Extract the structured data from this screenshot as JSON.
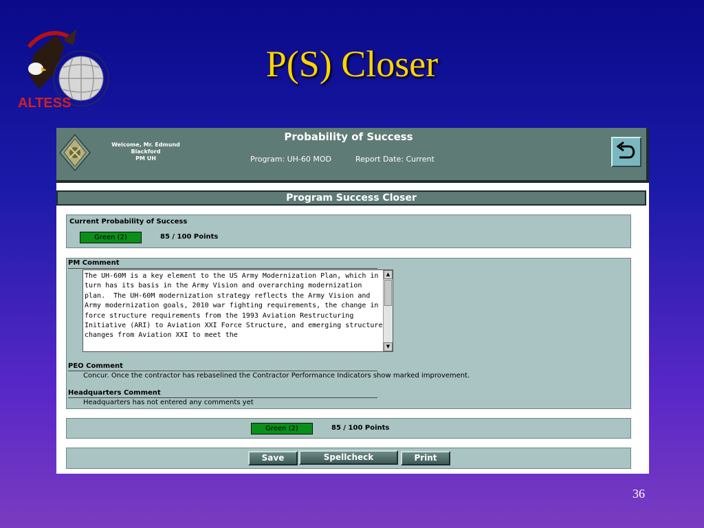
{
  "slide": {
    "title": "P(S) Closer",
    "logo_text": "ALTESS",
    "number": "36"
  },
  "header": {
    "welcome_lines": [
      "Welcome, Mr. Edmund",
      "Blackford",
      "PM UH"
    ],
    "title": "Probability of Success",
    "program": "Program: UH-60 MOD",
    "report_date": "Report Date: Current",
    "back_icon": "return-arrow-icon"
  },
  "section": {
    "title": "Program Success Closer"
  },
  "current_ps": {
    "label": "Current Probability of Success",
    "badge": "Green (2)",
    "points": "85 / 100 Points"
  },
  "comments": {
    "pm_label": "PM Comment",
    "pm_text": "The UH-60M is a key element to the US Army Modernization Plan, which in turn has its basis in the Army Vision and overarching modernization plan.  The UH-60M modernization strategy reflects the Army Vision and Army modernization goals, 2010 war fighting requirements, the change in force structure requirements from the 1993 Aviation Restructuring Initiative (ARI) to Aviation XXI Force Structure, and emerging structure changes from Aviation XXI to meet the",
    "peo_label": "PEO Comment",
    "peo_text": "Concur. Once the contractor has rebaselined the Contractor Performance Indicators show marked improvement.",
    "hq_label": "Headquarters Comment",
    "hq_text": "Headquarters has not entered any comments yet"
  },
  "summary": {
    "badge": "Green (2)",
    "points": "85 / 100 Points"
  },
  "buttons": {
    "save": "Save",
    "spellcheck": "Spellcheck",
    "print": "Print"
  },
  "colors": {
    "title_yellow": "#ffd400",
    "header_teal": "#5f7b75",
    "panel_bg": "#a9c4c2",
    "status_green": "#0a8f1a"
  }
}
